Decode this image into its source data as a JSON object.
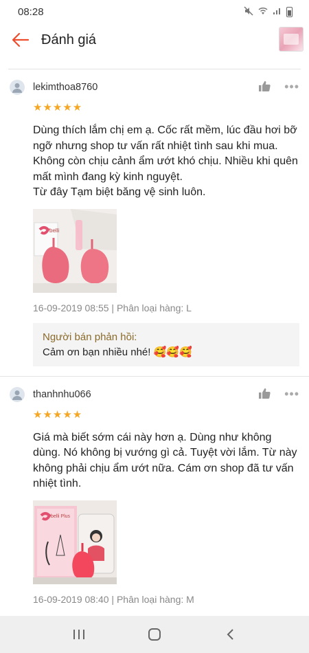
{
  "status": {
    "time": "08:28"
  },
  "header": {
    "title": "Đánh giá"
  },
  "reviews": [
    {
      "username": "lekimthoa8760",
      "stars": "★★★★★",
      "text": "Dùng thích lắm chị em ạ. Cốc rất mềm, lúc đầu hơi bỡ ngỡ nhưng shop tư vấn rất nhiệt tình sau khi mua. Không còn chịu cảnh ẩm ướt khó chịu. Nhiều khi quên mất mình đang kỳ kinh nguyệt.\nTừ đây Tạm biệt băng vệ sinh luôn.",
      "meta": "16-09-2019 08:55 | Phân loại hàng: L",
      "reply_label": "Người bán phản hồi:",
      "reply_text": "Cảm ơn bạn nhiều nhé! 🥰🥰🥰"
    },
    {
      "username": "thanhnhu066",
      "stars": "★★★★★",
      "text": "Giá mà biết sớm cái này hơn ạ. Dùng như không dùng. Nó không bị vướng gì cả. Tuyệt vời lắm. Từ này không phải chịu ẩm ướt nữa. Cám ơn shop đã tư vấn nhiệt tình.",
      "meta": "16-09-2019 08:40 | Phân loại hàng: M"
    }
  ],
  "colors": {
    "accent": "#ee4d2d",
    "star": "#f5a623",
    "reply_label": "#8a6a2a"
  }
}
